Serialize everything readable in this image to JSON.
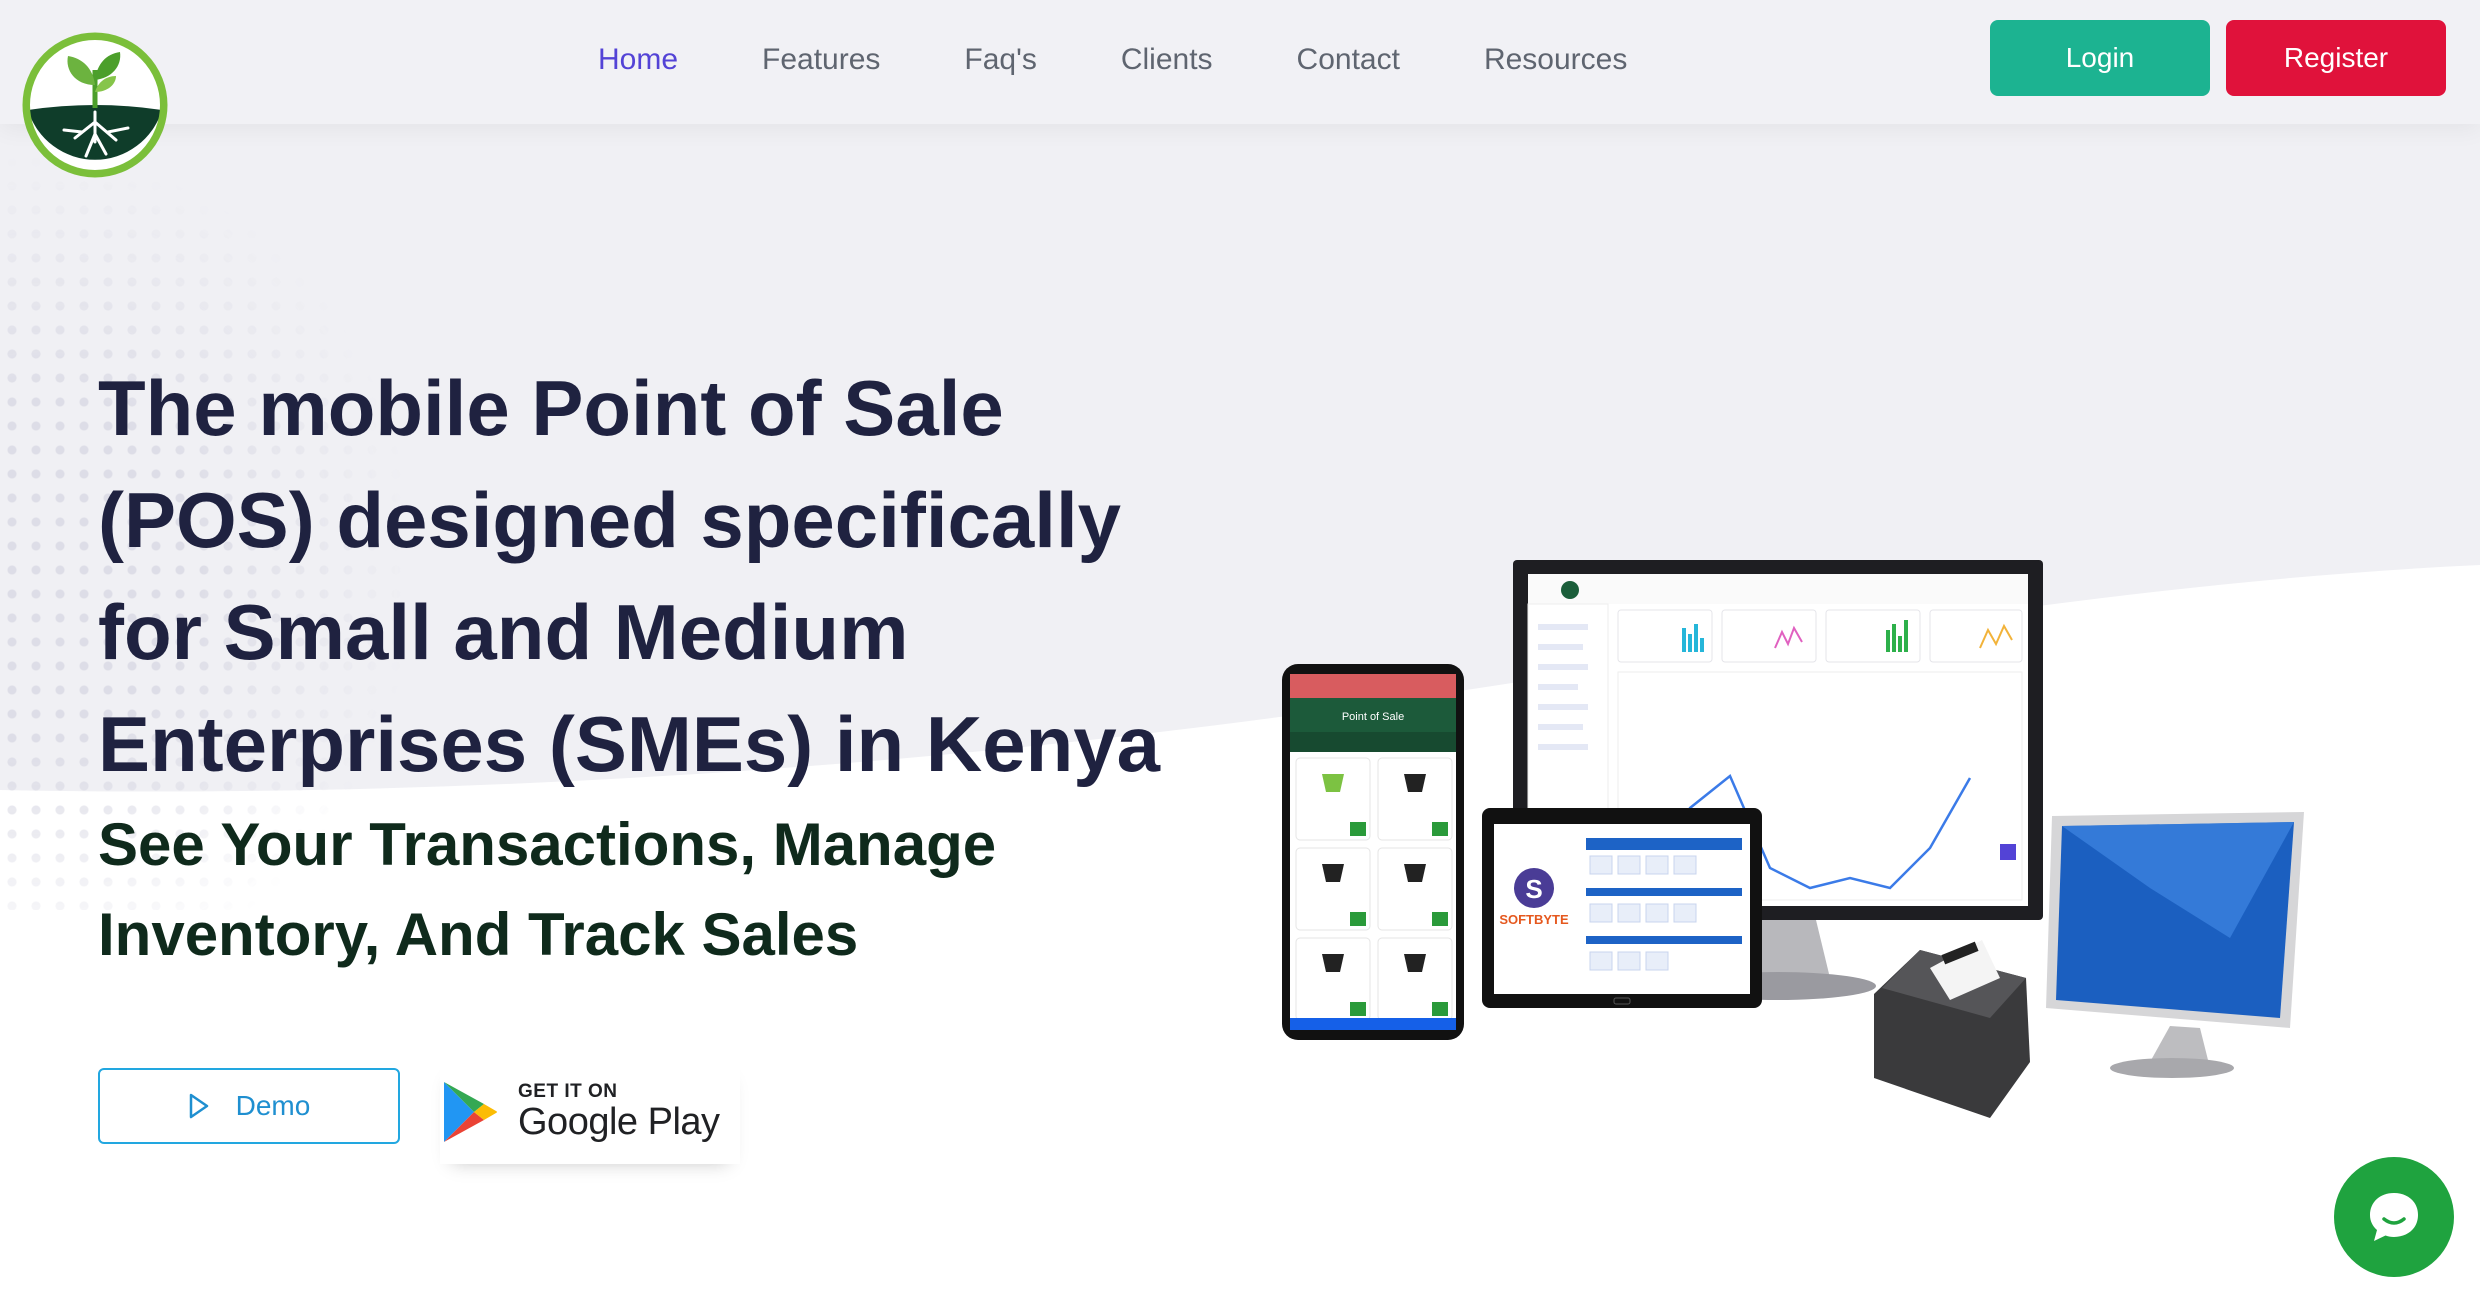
{
  "nav": {
    "items": [
      {
        "label": "Home",
        "active": true
      },
      {
        "label": "Features",
        "active": false
      },
      {
        "label": "Faq's",
        "active": false
      },
      {
        "label": "Clients",
        "active": false
      },
      {
        "label": "Contact",
        "active": false
      },
      {
        "label": "Resources",
        "active": false
      }
    ],
    "login_label": "Login",
    "register_label": "Register"
  },
  "hero": {
    "title": "The mobile Point of Sale (POS) designed specifically for Small and Medium Enterprises (SMEs) in Kenya",
    "subtitle": "See Your Transactions, Manage Inventory, And Track Sales",
    "demo_label": "Demo",
    "play_small": "GET IT ON",
    "play_big": "Google Play"
  },
  "devices": {
    "phone_header": "Point of Sale",
    "tablet_brand": "SOFTBYTE"
  },
  "colors": {
    "accent": "#5343d6",
    "login": "#1cb391",
    "register": "#e0123b",
    "title": "#1f2240",
    "chat": "#1fa33f"
  },
  "icons": [
    "logo-plant-icon",
    "play-icon",
    "google-play-icon",
    "chat-icon"
  ]
}
